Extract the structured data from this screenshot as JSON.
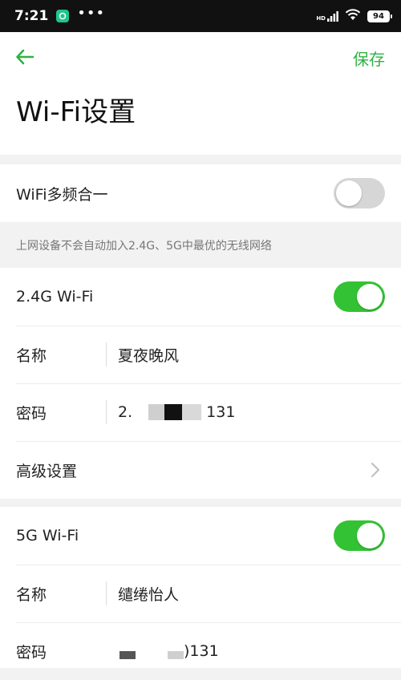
{
  "status_bar": {
    "time": "7:21",
    "dots": "•••",
    "network": "HD",
    "battery": "94"
  },
  "header": {
    "save_label": "保存",
    "title": "Wi-Fi设置"
  },
  "merge_section": {
    "label": "WiFi多频合一",
    "enabled": false,
    "hint": "上网设备不会自动加入2.4G、5G中最优的无线网络"
  },
  "wifi_24g": {
    "label": "2.4G Wi-Fi",
    "enabled": true,
    "name_label": "名称",
    "name_value": "夏夜晚风",
    "password_label": "密码",
    "password_prefix": "2.",
    "password_suffix": "131",
    "advanced_label": "高级设置"
  },
  "wifi_5g": {
    "label": "5G Wi-Fi",
    "enabled": true,
    "name_label": "名称",
    "name_value": "缱绻怡人",
    "password_label": "密码",
    "password_suffix": ")131"
  },
  "colors": {
    "accent": "#2fb344",
    "toggle_on": "#33c234",
    "toggle_off": "#d6d6d6"
  }
}
